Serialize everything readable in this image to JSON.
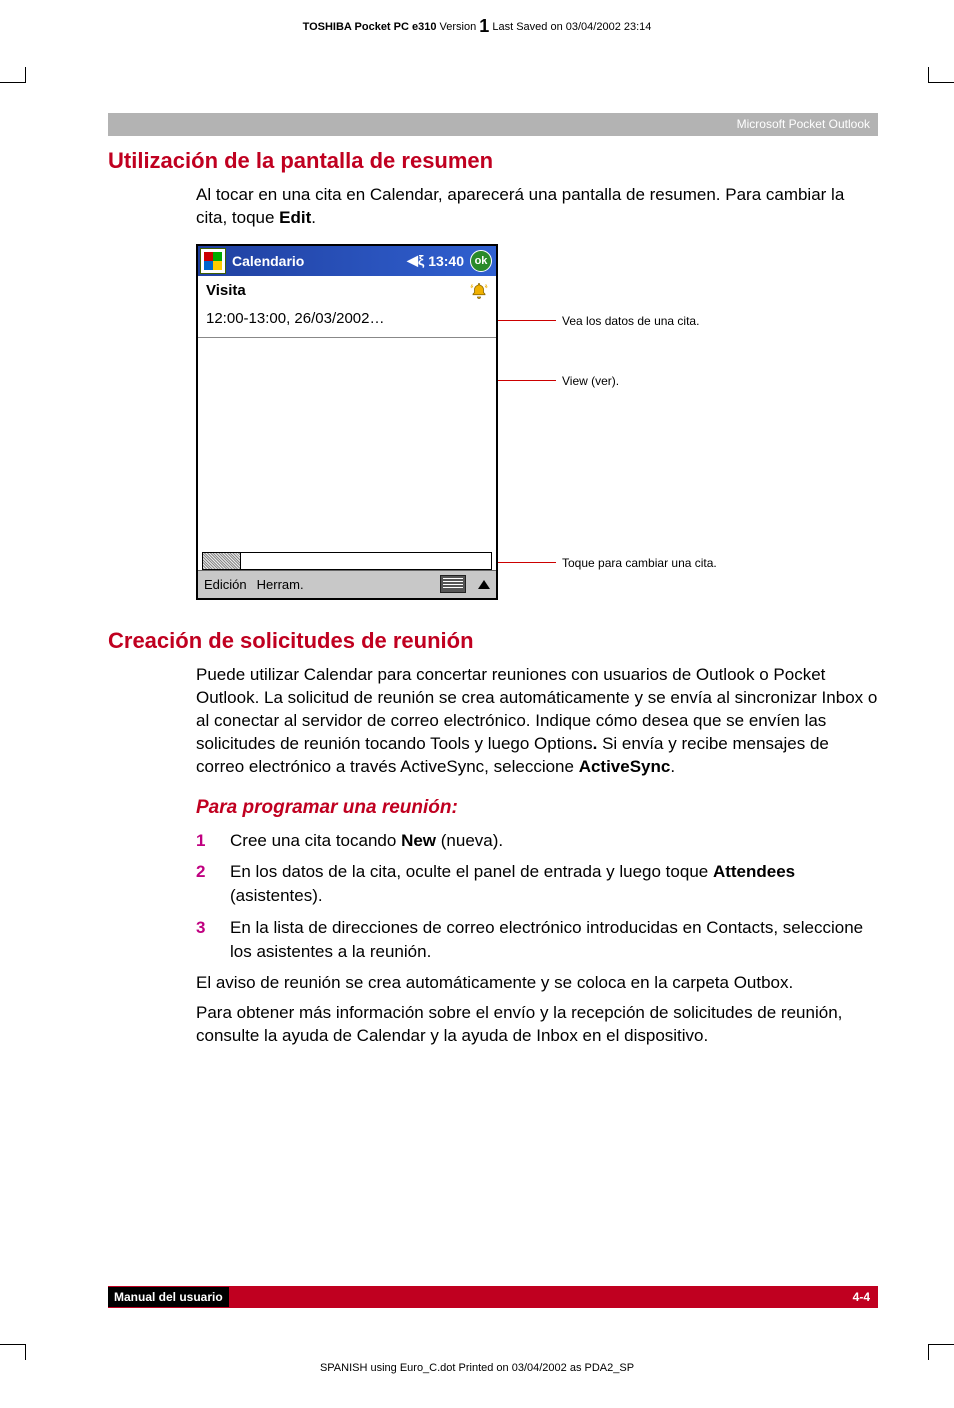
{
  "header": {
    "product_bold": "TOSHIBA Pocket PC e310",
    "version_label": "Version",
    "version_num": "1",
    "saved": "Last Saved on 03/04/2002 23:14"
  },
  "band": {
    "text": "Microsoft Pocket Outlook"
  },
  "section1": {
    "title": "Utilización de la pantalla de resumen",
    "p1a": "Al tocar en una cita en Calendar, aparecerá una pantalla de resumen. Para cambiar la cita, toque ",
    "p1b": "Edit",
    "p1c": "."
  },
  "device": {
    "title": "Calendario",
    "time": "13:40",
    "ok": "ok",
    "subject": "Visita",
    "timestamp": "12:00-13:00, 26/03/2002…",
    "menu1": "Edición",
    "menu2": "Herram."
  },
  "callouts": {
    "c1": "Vea los datos de una cita.",
    "c2": "View (ver).",
    "c3": "Toque para cambiar una cita."
  },
  "section2": {
    "title": "Creación de solicitudes de reunión",
    "p": "Puede utilizar Calendar para concertar reuniones con usuarios de Outlook o Pocket Outlook. La solicitud de reunión se crea automáticamente y se envía al sincronizar Inbox o al conectar al servidor de correo electrónico. Indique cómo desea que se envíen las solicitudes de reunión tocando Tools y luego Options",
    "p_b": ".",
    "p_c": " Si envía y recibe mensajes de correo electrónico a través ActiveSync, seleccione ",
    "p_d": "ActiveSync",
    "p_e": "."
  },
  "section3": {
    "title": "Para programar una reunión:",
    "s1a": "Cree una cita tocando ",
    "s1b": "New",
    "s1c": " (nueva).",
    "s2a": "En los datos de la cita, oculte el panel de entrada y luego toque ",
    "s2b": "Attendees",
    "s2c": " (asistentes).",
    "s3": "En la lista de direcciones de correo electrónico introducidas en Contacts, seleccione los asistentes a la reunión.",
    "p4": "El aviso de reunión se crea automáticamente y se coloca en la carpeta Outbox.",
    "p5": "Para obtener más información sobre el envío y la recepción de solicitudes de reunión, consulte la ayuda de Calendar y la ayuda de Inbox en el dispositivo."
  },
  "footer": {
    "left": "Manual del usuario",
    "right": "4-4"
  },
  "print": {
    "text": "SPANISH using Euro_C.dot  Printed on 03/04/2002 as PDA2_SP"
  },
  "nums": {
    "n1": "1",
    "n2": "2",
    "n3": "3"
  }
}
